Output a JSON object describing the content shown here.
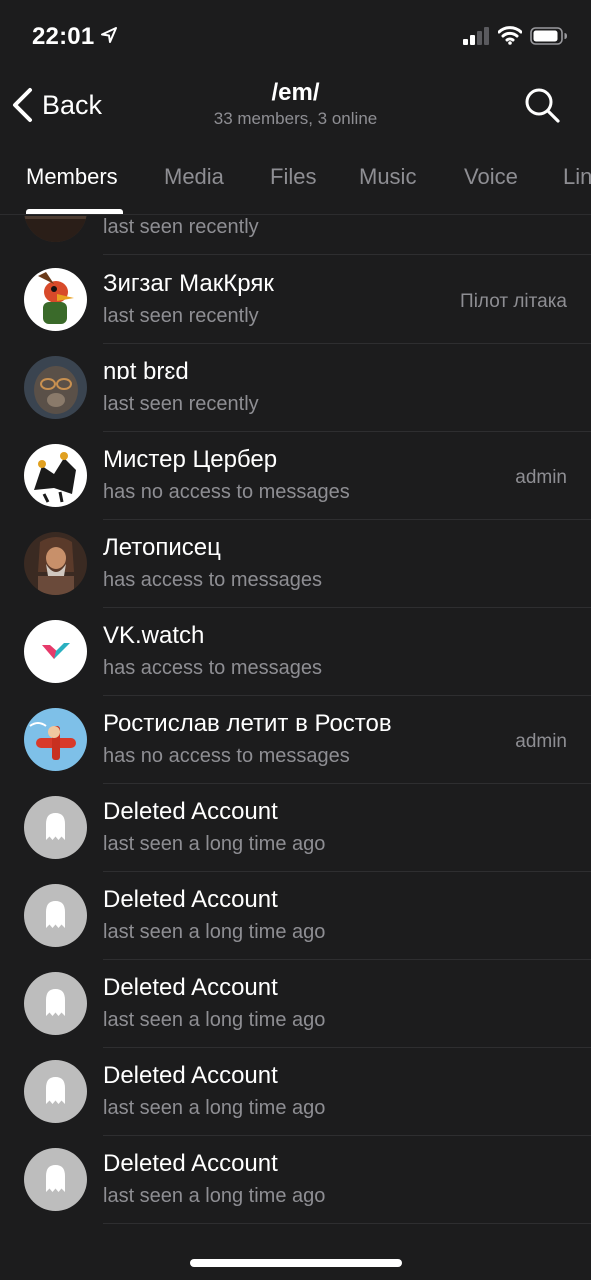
{
  "status_bar": {
    "time": "22:01"
  },
  "nav": {
    "back_label": "Back",
    "title": "/em/",
    "subtitle": "33 members, 3 online"
  },
  "tabs": [
    {
      "label": "Members",
      "active": true
    },
    {
      "label": "Media"
    },
    {
      "label": "Files"
    },
    {
      "label": "Music"
    },
    {
      "label": "Voice"
    },
    {
      "label": "Links"
    }
  ],
  "members": [
    {
      "name": "",
      "status": "last seen recently",
      "role": ""
    },
    {
      "name": "Зигзаг МакКряк",
      "status": "last seen recently",
      "role": "Пілот літака"
    },
    {
      "name": "nɒt brɛd",
      "status": "last seen recently",
      "role": ""
    },
    {
      "name": "Мистер Цербер",
      "status": "has no access to messages",
      "role": "admin"
    },
    {
      "name": "Летописец",
      "status": "has access to messages",
      "role": ""
    },
    {
      "name": "VK.watch",
      "status": "has access to messages",
      "role": ""
    },
    {
      "name": "Ростислав летит в Ростов",
      "status": "has no access to messages",
      "role": "admin"
    },
    {
      "name": "Deleted Account",
      "status": "last seen a long time ago",
      "role": ""
    },
    {
      "name": "Deleted Account",
      "status": "last seen a long time ago",
      "role": ""
    },
    {
      "name": "Deleted Account",
      "status": "last seen a long time ago",
      "role": ""
    },
    {
      "name": "Deleted Account",
      "status": "last seen a long time ago",
      "role": ""
    },
    {
      "name": "Deleted Account",
      "status": "last seen a long time ago",
      "role": ""
    }
  ],
  "colors": {
    "background": "#1c1c1d",
    "text_primary": "#ffffff",
    "text_secondary": "#8e8e93",
    "ghost_avatar": "#bdbdbd"
  }
}
